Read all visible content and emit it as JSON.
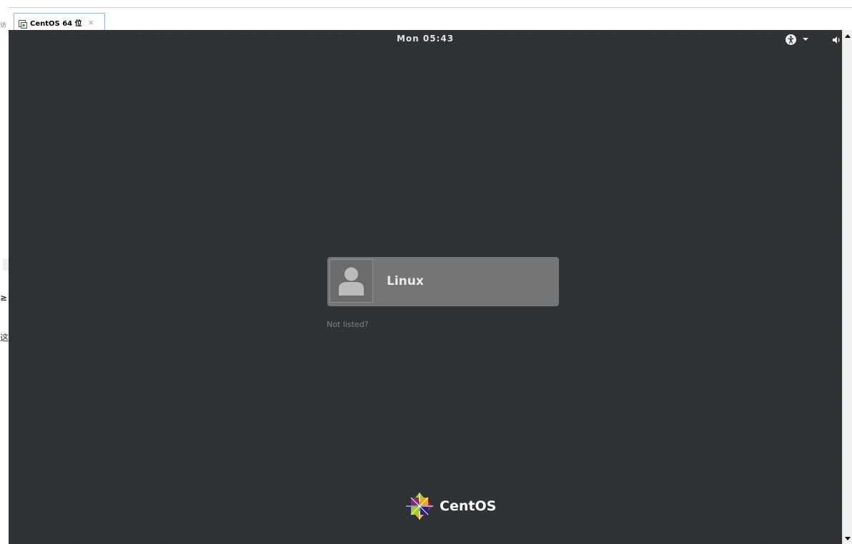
{
  "host": {
    "fragments": [
      "访",
      "≥",
      "这"
    ]
  },
  "tab": {
    "title": "CentOS 64 位",
    "close": "×",
    "icon": "vm-running-icon"
  },
  "topbar": {
    "clock": "Mon 05:43",
    "icons": [
      "accessibility-icon",
      "dropdown-caret-icon",
      "volume-icon"
    ]
  },
  "login": {
    "user_name": "Linux",
    "avatar_icon": "user-avatar-icon",
    "not_listed": "Not listed?"
  },
  "brand": {
    "text": "CentOS",
    "logo_icon": "centos-logo-icon",
    "colors": [
      "#9ccd2a",
      "#932279",
      "#efa724",
      "#262577"
    ]
  },
  "colors": {
    "background": "#2e3133",
    "user_card": "#737577",
    "text_light": "#dfe3e4",
    "text_dim": "#7e8183"
  }
}
